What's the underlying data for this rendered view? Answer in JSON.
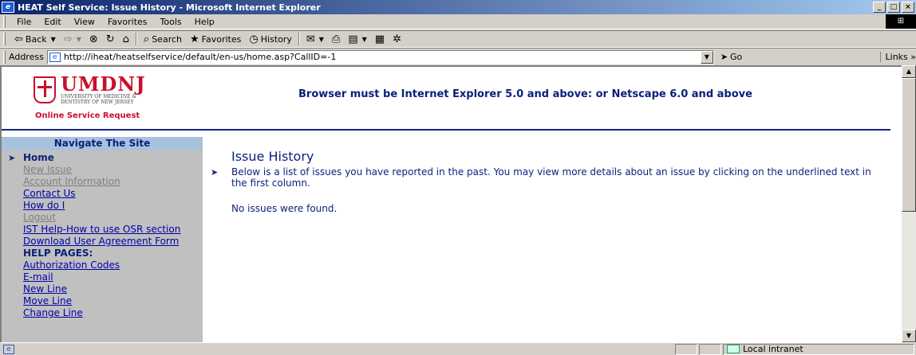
{
  "window": {
    "title": "HEAT Self Service: Issue History - Microsoft Internet Explorer",
    "controls": [
      "_",
      "□",
      "×"
    ]
  },
  "menu": [
    "File",
    "Edit",
    "View",
    "Favorites",
    "Tools",
    "Help"
  ],
  "toolbar": {
    "back": "Back",
    "search": "Search",
    "favorites": "Favorites",
    "history": "History"
  },
  "address": {
    "label": "Address",
    "url": "http://iheat/heatselfservice/default/en-us/home.asp?CallID=-1",
    "go": "Go",
    "links": "Links »"
  },
  "logo": {
    "name": "UMDNJ",
    "line1": "UNIVERSITY OF MEDICINE &",
    "line2": "DENTISTRY OF NEW JERSEY",
    "subtitle": "Online Service Request"
  },
  "browser_notice": "Browser must be Internet Explorer 5.0 and above: or Netscape 6.0 and above",
  "sidebar": {
    "title": "Navigate The Site",
    "items": [
      {
        "label": "Home",
        "state": "current"
      },
      {
        "label": "New Issue",
        "state": "disabled"
      },
      {
        "label": "Account Information",
        "state": "disabled"
      },
      {
        "label": "Contact Us",
        "state": "link"
      },
      {
        "label": "How do I",
        "state": "link"
      },
      {
        "label": "Logout",
        "state": "disabled"
      },
      {
        "label": "IST Help-How to use OSR section",
        "state": "link"
      },
      {
        "label": "Download User Agreement Form",
        "state": "link"
      },
      {
        "label": "HELP PAGES:",
        "state": "heading"
      },
      {
        "label": "Authorization Codes",
        "state": "link"
      },
      {
        "label": "E-mail",
        "state": "link"
      },
      {
        "label": "New Line",
        "state": "link"
      },
      {
        "label": "Move Line",
        "state": "link"
      },
      {
        "label": "Change Line",
        "state": "link"
      }
    ]
  },
  "main": {
    "heading": "Issue History",
    "intro": "Below is a list of issues you have reported in the past.  You may view more details about an issue by clicking on the underlined text in the first column.",
    "empty_message": "No issues were found."
  },
  "status": {
    "zone": "Local intranet"
  }
}
